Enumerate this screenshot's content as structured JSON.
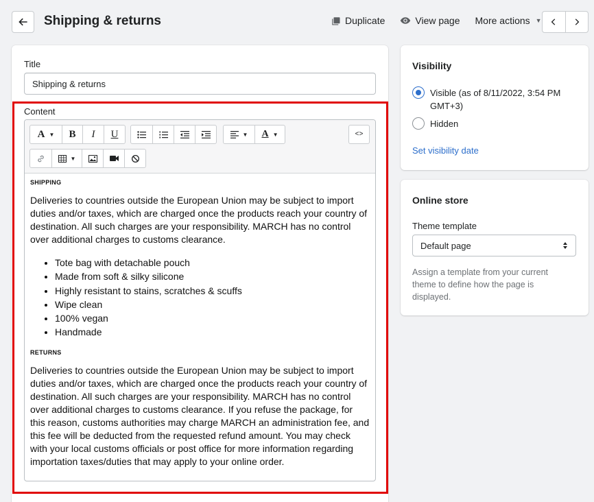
{
  "header": {
    "title": "Shipping & returns",
    "actions": {
      "duplicate": "Duplicate",
      "view_page": "View page",
      "more_actions": "More actions"
    }
  },
  "main": {
    "title_label": "Title",
    "title_value": "Shipping & returns",
    "content_label": "Content",
    "toolbar": {
      "bold": "B",
      "italic": "I",
      "underline": "U",
      "html": "<>"
    },
    "body": {
      "shipping_heading": "SHIPPING",
      "shipping_text": "Deliveries to countries outside the European Union may be subject to import duties and/or taxes, which are charged once the products reach your country of destination. All such charges are your responsibility. MARCH has no control over additional charges to customs clearance.",
      "bullets": [
        "Tote bag with detachable pouch",
        "Made from soft & silky silicone",
        "Highly resistant to stains, scratches & scuffs",
        "Wipe clean",
        "100% vegan",
        "Handmade"
      ],
      "returns_heading": "RETURNS",
      "returns_text": "Deliveries to countries outside the European Union may be subject to import duties and/or taxes, which are charged once the products reach your country of destination. All such charges are your responsibility. MARCH has no control over additional charges to customs clearance. If you refuse the package, for this reason, customs authorities may charge MARCH an administration fee, and this fee will be deducted from the requested refund amount. You may check with your local customs officials or post office for more information regarding importation taxes/duties that may apply to your online order."
    }
  },
  "visibility": {
    "title": "Visibility",
    "visible_label": "Visible (as of 8/11/2022, 3:54 PM GMT+3)",
    "hidden_label": "Hidden",
    "selected": "visible",
    "set_date_link": "Set visibility date"
  },
  "online_store": {
    "title": "Online store",
    "theme_template_label": "Theme template",
    "theme_template_value": "Default page",
    "help_text": "Assign a template from your current theme to define how the page is displayed."
  },
  "colors": {
    "accent": "#2c6ecb",
    "highlight_border": "#e00000",
    "background": "#f1f2f4"
  }
}
